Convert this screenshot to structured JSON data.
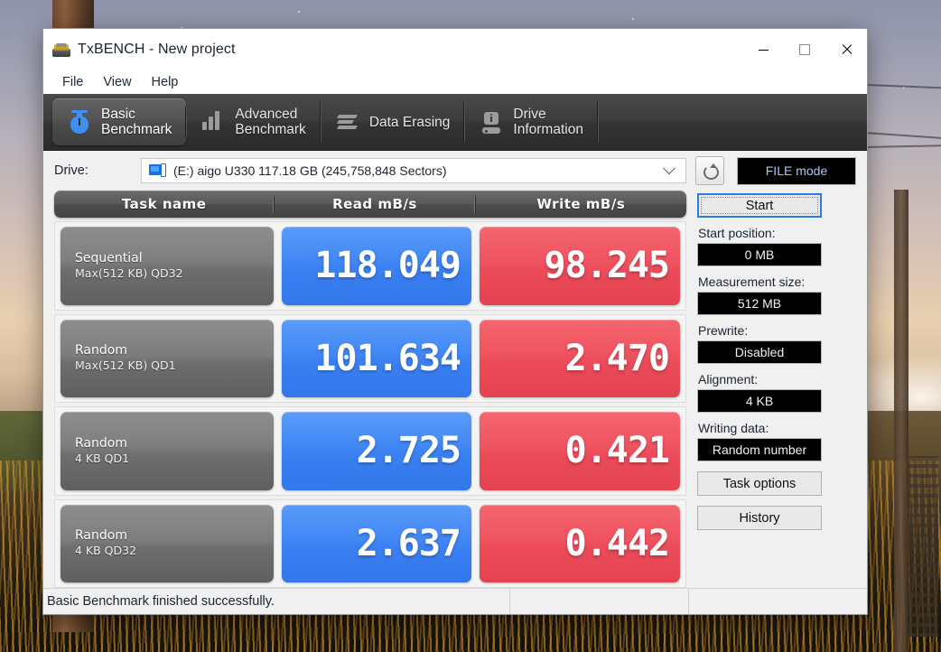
{
  "window": {
    "title": "TxBENCH - New project",
    "icon": "drive-icon",
    "controls": {
      "minimize": "minimize-icon",
      "maximize": "maximize-icon",
      "close": "close-icon"
    }
  },
  "menu": {
    "items": [
      "File",
      "View",
      "Help"
    ]
  },
  "tabs": [
    {
      "label": "Basic\nBenchmark",
      "icon": "stopwatch-icon",
      "active": true
    },
    {
      "label": "Advanced\nBenchmark",
      "icon": "bar-chart-icon",
      "active": false
    },
    {
      "label": "Data Erasing",
      "icon": "erase-icon",
      "active": false
    },
    {
      "label": "Drive\nInformation",
      "icon": "drive-info-icon",
      "active": false
    }
  ],
  "drive": {
    "label": "Drive:",
    "selected": "(E:) aigo U330  117.18 GB (245,758,848 Sectors)",
    "icon": "drive-select-icon",
    "dropdown_icon": "chevron-down-icon",
    "refresh_icon": "refresh-icon",
    "mode_button": "FILE mode"
  },
  "table": {
    "headers": {
      "task": "Task name",
      "read": "Read mB/s",
      "write": "Write mB/s"
    },
    "rows": [
      {
        "name_line1": "Sequential",
        "name_line2": "Max(512 KB) QD32",
        "read": "118.049",
        "write": "98.245"
      },
      {
        "name_line1": "Random",
        "name_line2": "Max(512 KB) QD1",
        "read": "101.634",
        "write": "2.470"
      },
      {
        "name_line1": "Random",
        "name_line2": "4 KB QD1",
        "read": "2.725",
        "write": "0.421"
      },
      {
        "name_line1": "Random",
        "name_line2": "4 KB QD32",
        "read": "2.637",
        "write": "0.442"
      }
    ]
  },
  "panel": {
    "start_button": "Start",
    "fields": [
      {
        "label": "Start position:",
        "value": "0 MB"
      },
      {
        "label": "Measurement size:",
        "value": "512 MB"
      },
      {
        "label": "Prewrite:",
        "value": "Disabled"
      },
      {
        "label": "Alignment:",
        "value": "4 KB"
      },
      {
        "label": "Writing data:",
        "value": "Random number"
      }
    ],
    "task_options_button": "Task options",
    "history_button": "History"
  },
  "status": {
    "message": "Basic Benchmark finished successfully."
  },
  "colors": {
    "read_cell": "#4187f5",
    "write_cell": "#ef5360",
    "tab_active": "#545454",
    "accent_focus": "#2a7de1",
    "field_bg": "#000000",
    "field_text": "#f0f0f0"
  }
}
